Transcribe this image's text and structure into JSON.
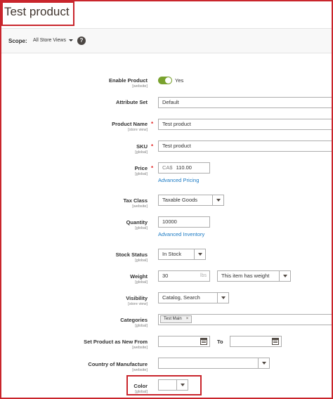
{
  "page": {
    "title": "Test product"
  },
  "scope": {
    "label": "Scope:",
    "value": "All Store Views",
    "help": "?"
  },
  "form": {
    "enable_product": {
      "label": "Enable Product",
      "scope": "[website]",
      "value": "Yes"
    },
    "attribute_set": {
      "label": "Attribute Set",
      "value": "Default"
    },
    "product_name": {
      "label": "Product Name",
      "scope": "[store view]",
      "value": "Test product",
      "required": "*"
    },
    "sku": {
      "label": "SKU",
      "scope": "[global]",
      "value": "Test product",
      "required": "*"
    },
    "price": {
      "label": "Price",
      "scope": "[global]",
      "currency": "CA$",
      "value": "110.00",
      "required": "*",
      "advanced_link": "Advanced Pricing"
    },
    "tax_class": {
      "label": "Tax Class",
      "scope": "[website]",
      "value": "Taxable Goods"
    },
    "quantity": {
      "label": "Quantity",
      "scope": "[global]",
      "value": "10000",
      "advanced_link": "Advanced Inventory"
    },
    "stock_status": {
      "label": "Stock Status",
      "scope": "[global]",
      "value": "In Stock"
    },
    "weight": {
      "label": "Weight",
      "scope": "[global]",
      "value": "30",
      "unit": "lbs",
      "has_weight": "This item has weight"
    },
    "visibility": {
      "label": "Visibility",
      "scope": "[store view]",
      "value": "Catalog, Search"
    },
    "categories": {
      "label": "Categories",
      "scope": "[global]",
      "tags": [
        "Test Main"
      ],
      "remove": "×"
    },
    "new_from": {
      "label": "Set Product as New From",
      "scope": "[website]",
      "from_value": "",
      "to_label": "To",
      "to_value": ""
    },
    "country": {
      "label": "Country of Manufacture",
      "scope": "[website]",
      "value": ""
    },
    "color": {
      "label": "Color",
      "scope": "[global]",
      "value": ""
    }
  },
  "colors": {
    "required": "#e22626",
    "link": "#1979c3",
    "toggle_on": "#79a22e",
    "highlight": "#c9252c"
  }
}
